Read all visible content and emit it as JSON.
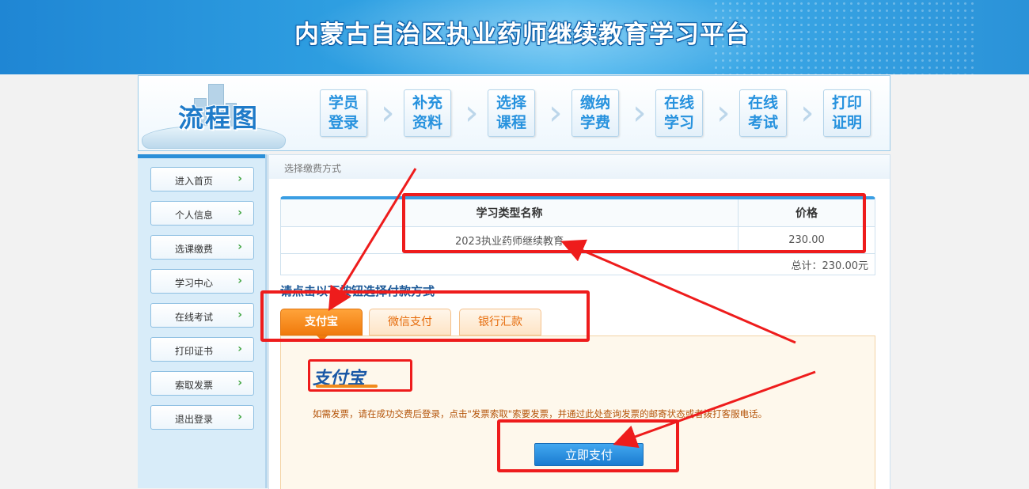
{
  "banner": {
    "title": "内蒙古自治区执业药师继续教育学习平台"
  },
  "flow": {
    "logo_text": "流程图",
    "steps": [
      {
        "line1": "学员",
        "line2": "登录"
      },
      {
        "line1": "补充",
        "line2": "资料"
      },
      {
        "line1": "选择",
        "line2": "课程"
      },
      {
        "line1": "缴纳",
        "line2": "学费"
      },
      {
        "line1": "在线",
        "line2": "学习"
      },
      {
        "line1": "在线",
        "line2": "考试"
      },
      {
        "line1": "打印",
        "line2": "证明"
      }
    ]
  },
  "sidebar": {
    "items": [
      {
        "label": "进入首页"
      },
      {
        "label": "个人信息"
      },
      {
        "label": "选课缴费"
      },
      {
        "label": "学习中心"
      },
      {
        "label": "在线考试"
      },
      {
        "label": "打印证书"
      },
      {
        "label": "索取发票"
      },
      {
        "label": "退出登录"
      }
    ],
    "arrow": "›"
  },
  "main": {
    "breadcrumb": "选择缴费方式",
    "order": {
      "headers": [
        "学习类型名称",
        "价格"
      ],
      "rows": [
        {
          "name": "2023执业药师继续教育",
          "price": "230.00"
        }
      ],
      "total": "总计：230.00元"
    },
    "pay_title": "请点击以下按钮选择付款方式",
    "tabs": [
      {
        "label": "支付宝",
        "active": true
      },
      {
        "label": "微信支付",
        "active": false
      },
      {
        "label": "银行汇款",
        "active": false
      }
    ],
    "alipay_logo_text": "支付宝",
    "notice": "如需发票，请在成功交费后登录，点击\"发票索取\"索要发票，并通过此处查询发票的邮寄状态或者拨打客服电话。",
    "pay_button": "立即支付"
  },
  "colors": {
    "accent_blue": "#2b8fd8",
    "tab_orange": "#f07a0c",
    "annotation_red": "#ee1c1c"
  }
}
